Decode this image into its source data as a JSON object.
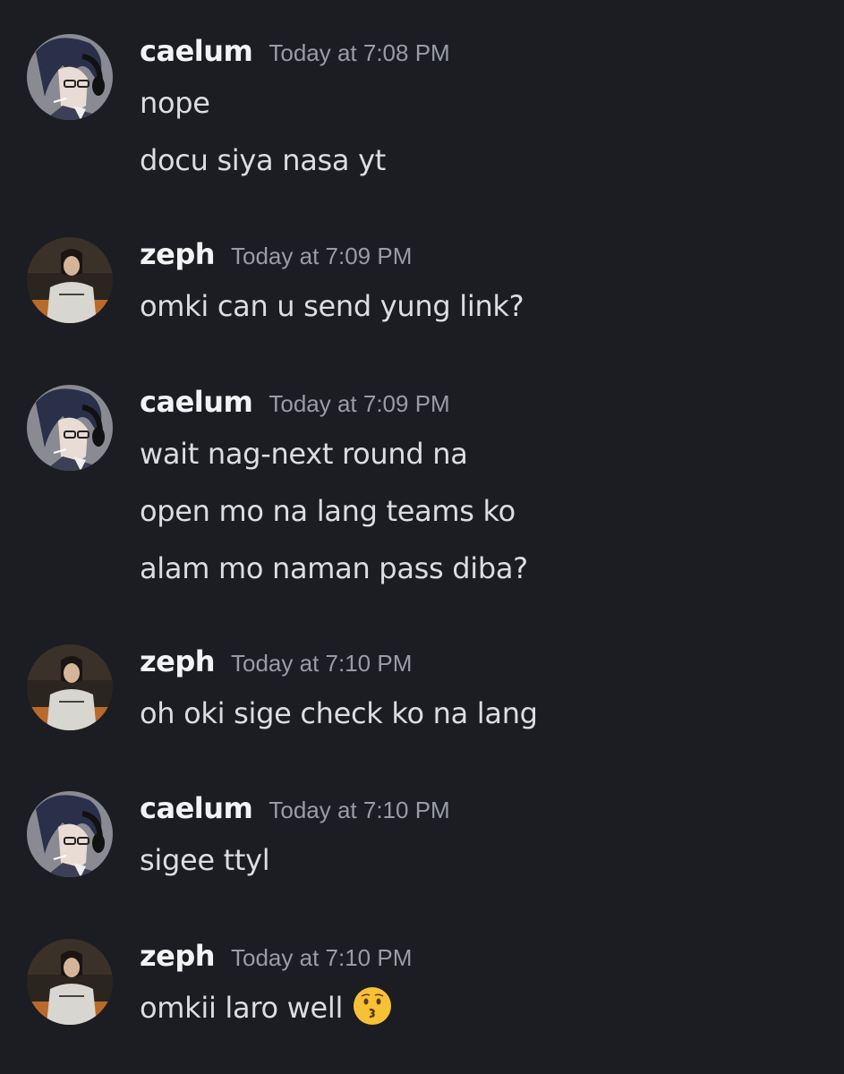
{
  "messages": [
    {
      "author": "caelum",
      "time": "Today at 7:08 PM",
      "lines": [
        "nope",
        "docu siya nasa yt"
      ]
    },
    {
      "author": "zeph",
      "time": "Today at 7:09 PM",
      "lines": [
        "omki can u send yung link?"
      ]
    },
    {
      "author": "caelum",
      "time": "Today at 7:09 PM",
      "lines": [
        "wait nag-next round na",
        "open mo na lang teams ko",
        "alam mo naman pass diba?"
      ]
    },
    {
      "author": "zeph",
      "time": "Today at 7:10 PM",
      "lines": [
        "oh oki sige check ko na lang"
      ]
    },
    {
      "author": "caelum",
      "time": "Today at 7:10 PM",
      "lines": [
        "sigee ttyl"
      ]
    },
    {
      "author": "zeph",
      "time": "Today at 7:10 PM",
      "lines": [
        "omkii laro well"
      ],
      "emoji": "kissing-face-emoji"
    }
  ],
  "colors": {
    "background": "#1c1d22",
    "username": "#f2f3f5",
    "timestamp": "#9a9ca5",
    "message_text": "#dcdde1"
  }
}
